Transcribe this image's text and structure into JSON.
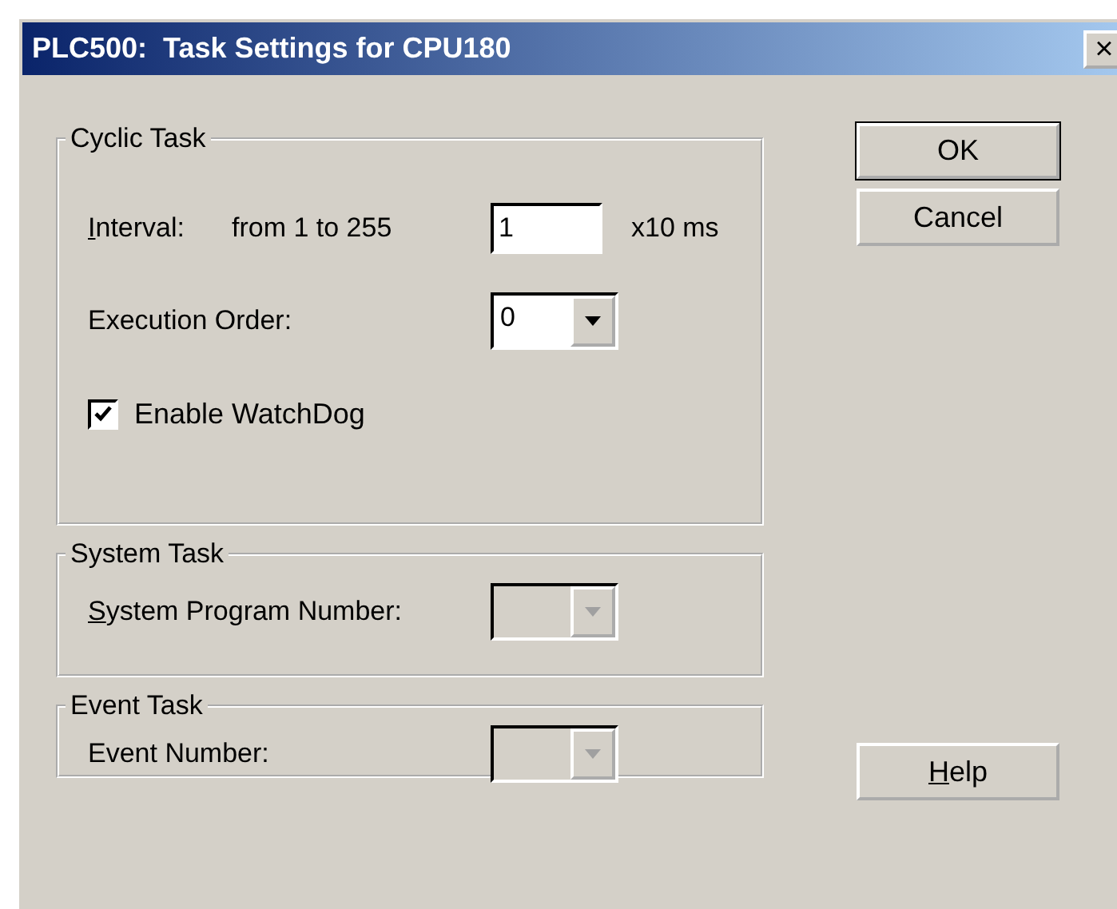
{
  "window": {
    "title": "PLC500:  Task Settings for CPU180",
    "close": "×"
  },
  "groups": [
    {
      "title": "Cyclic Task",
      "rows": [
        {
          "kind": "text-input",
          "label": "Interval:",
          "mnemonic": true,
          "hint": "from 1 to 255",
          "value": "1",
          "suffix": "x10 ms"
        },
        {
          "kind": "combo",
          "label": "Execution Order:",
          "mnemonic": false,
          "value": "0",
          "disabled": false
        },
        {
          "kind": "checkbox",
          "label": "Enable WatchDog",
          "checked": true
        }
      ]
    },
    {
      "title": "System Task",
      "rows": [
        {
          "kind": "combo",
          "label": "System Program Number:",
          "mnemonic": true,
          "disabled": true
        }
      ]
    },
    {
      "title": "Event Task",
      "rows": [
        {
          "kind": "combo",
          "label": "Event Number:",
          "mnemonic": false,
          "disabled": true
        }
      ]
    }
  ],
  "buttons": [
    {
      "label": "OK",
      "default": true,
      "mnemonic": false
    },
    {
      "label": "Cancel",
      "default": false,
      "mnemonic": false
    },
    {
      "label": "Help",
      "default": false,
      "mnemonic": true
    }
  ]
}
